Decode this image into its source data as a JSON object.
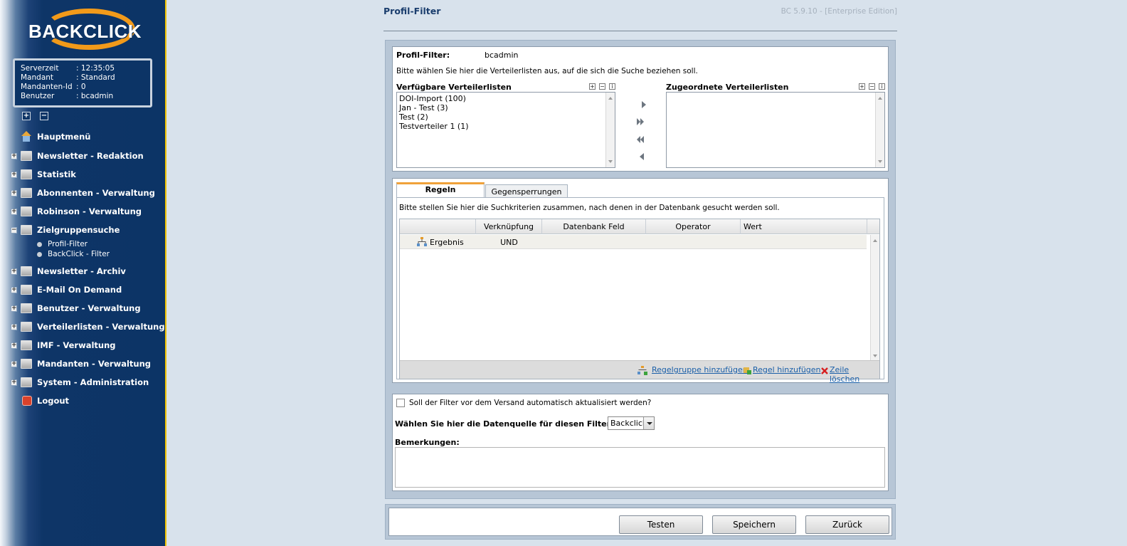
{
  "brand": {
    "logo_text": "BACKCLICK"
  },
  "server_info": {
    "rows": [
      {
        "label": "Serverzeit",
        "value": ": 12:35:05"
      },
      {
        "label": "Mandant",
        "value": ": Standard"
      },
      {
        "label": "Mandanten-Id",
        "value": ": 0"
      },
      {
        "label": "Benutzer",
        "value": ": bcadmin"
      }
    ]
  },
  "tree_controls": {
    "expand": "+",
    "collapse": "−"
  },
  "nav": {
    "home": "Hauptmenü",
    "items": [
      "Newsletter - Redaktion",
      "Statistik",
      "Abonnenten - Verwaltung",
      "Robinson - Verwaltung",
      "Zielgruppensuche",
      "Newsletter - Archiv",
      "E-Mail On Demand",
      "Benutzer - Verwaltung",
      "Verteilerlisten - Verwaltung",
      "IMF - Verwaltung",
      "Mandanten - Verwaltung",
      "System - Administration"
    ],
    "sub_items": [
      "Profil-Filter",
      "BackClick - Filter"
    ],
    "logout": "Logout"
  },
  "header": {
    "title": "Profil-Filter",
    "version": "BC 5.9.10 - [Enterprise Edition]"
  },
  "profile": {
    "label": "Profil-Filter:",
    "value": "bcadmin",
    "instruction": "Bitte wählen Sie hier die Verteilerlisten aus, auf die sich die Suche beziehen soll."
  },
  "lists": {
    "available_title": "Verfügbare Verteilerlisten",
    "assigned_title": "Zugeordnete Verteilerlisten",
    "available_items": [
      "DOI-Import (100)",
      "Jan - Test (3)",
      "Test (2)",
      "Testverteiler 1 (1)"
    ],
    "assigned_items": [],
    "mini_buttons": [
      "+",
      "−",
      "i"
    ]
  },
  "tabs": [
    {
      "label": "Regeln",
      "active": true
    },
    {
      "label": "Gegensperrungen",
      "active": false
    }
  ],
  "rules": {
    "instruction": "Bitte stellen Sie hier die Suchkriterien zusammen, nach denen in der Datenbank gesucht werden soll.",
    "columns": [
      "",
      "Verknüpfung",
      "Datenbank Feld",
      "Operator",
      "Wert"
    ],
    "rows": [
      {
        "name": "Ergebnis",
        "link": "UND",
        "field": "",
        "operator": "",
        "value": ""
      }
    ],
    "actions": [
      "Regelgruppe hinzufügen",
      "Regel hinzufügen",
      "Zeile löschen"
    ]
  },
  "options": {
    "auto_update_label": "Soll der Filter vor dem Versand automatisch aktualisiert werden?",
    "auto_update_checked": false,
    "datasource_label": "Wählen Sie hier die Datenquelle für diesen Filter aus:",
    "datasource_value": "Backclick",
    "remarks_label": "Bemerkungen:",
    "remarks_value": ""
  },
  "buttons": {
    "test": "Testen",
    "save": "Speichern",
    "back": "Zurück"
  },
  "colors": {
    "sidebar": "#0c3466",
    "accent": "#f29a1a",
    "tab_accent": "#f0a23a",
    "link": "#1a5fa8"
  }
}
